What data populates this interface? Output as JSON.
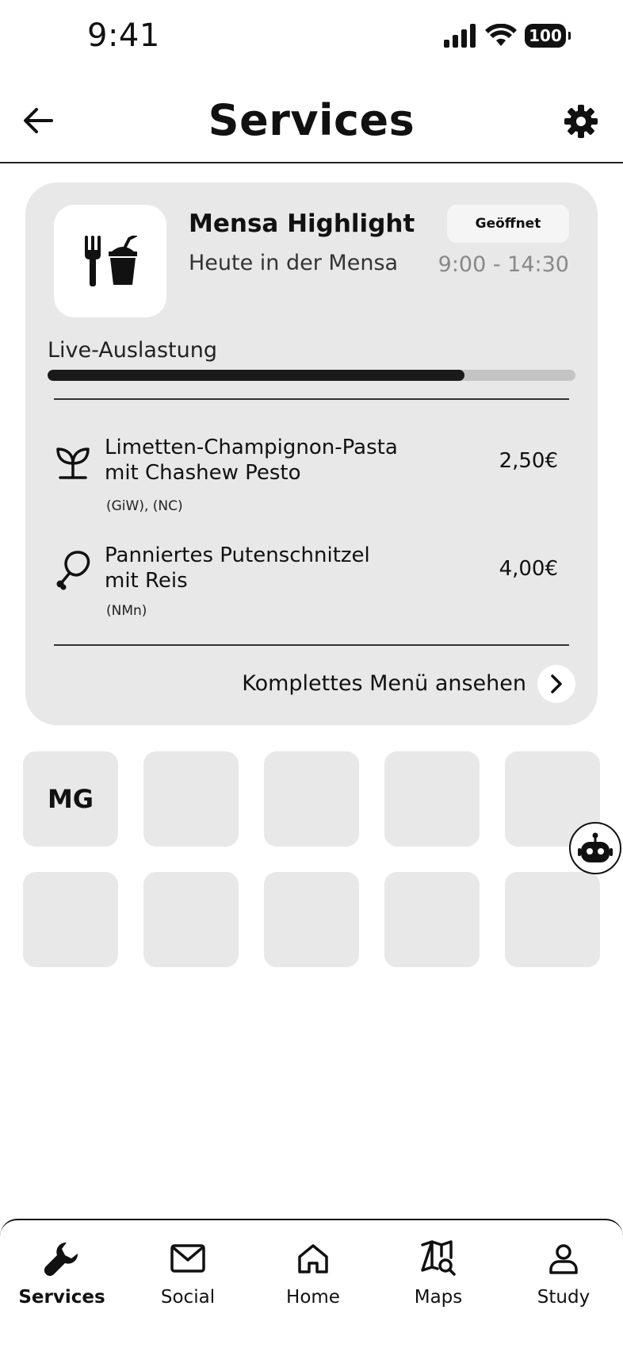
{
  "status_bar": {
    "time": "9:41",
    "battery": "100"
  },
  "header": {
    "title": "Services"
  },
  "mensa": {
    "title": "Mensa Highlight",
    "subtitle": "Heute in der Mensa",
    "status": "Geöffnet",
    "hours": "9:00 - 14:30",
    "load_label": "Live-Auslastung",
    "load_fraction": 0.79,
    "items": [
      {
        "name_line1": "Limetten-Champignon-Pasta",
        "name_line2": "mit Chashew Pesto",
        "allergens": "(GiW), (NC)",
        "price": "2,50€",
        "icon": "sprout-icon"
      },
      {
        "name_line1": "Panniertes Putenschnitzel",
        "name_line2": "mit Reis",
        "allergens": "(NMn)",
        "price": "4,00€",
        "icon": "drumstick-icon"
      }
    ],
    "full_menu_label": "Komplettes Menü ansehen"
  },
  "tiles": {
    "first_label": "MG"
  },
  "nav": {
    "items": [
      {
        "label": "Services",
        "icon": "wrench-icon",
        "active": true
      },
      {
        "label": "Social",
        "icon": "mail-icon"
      },
      {
        "label": "Home",
        "icon": "home-icon"
      },
      {
        "label": "Maps",
        "icon": "map-search-icon"
      },
      {
        "label": "Study",
        "icon": "user-icon"
      }
    ]
  }
}
